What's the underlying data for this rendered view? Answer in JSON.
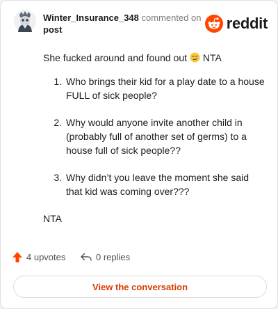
{
  "header": {
    "author": "Winter_Insurance_348",
    "action": "commented on",
    "link": "post",
    "brand": "reddit"
  },
  "comment": {
    "intro_before": "She fucked around and found out",
    "intro_after": "NTA",
    "items": [
      "Who brings their kid for a play date to a house FULL of sick people?",
      "Why would anyone invite another child in (probably full of another set of germs) to a house full of sick people??",
      "Why didn’t you leave the moment she said that kid was coming over???"
    ],
    "outro": "NTA"
  },
  "footer": {
    "upvotes": "4 upvotes",
    "replies": "0 replies"
  },
  "cta": {
    "label": "View the conversation"
  },
  "colors": {
    "accent": "#ff4500",
    "cta_text": "#d93a00",
    "text": "#1c1c1c"
  }
}
